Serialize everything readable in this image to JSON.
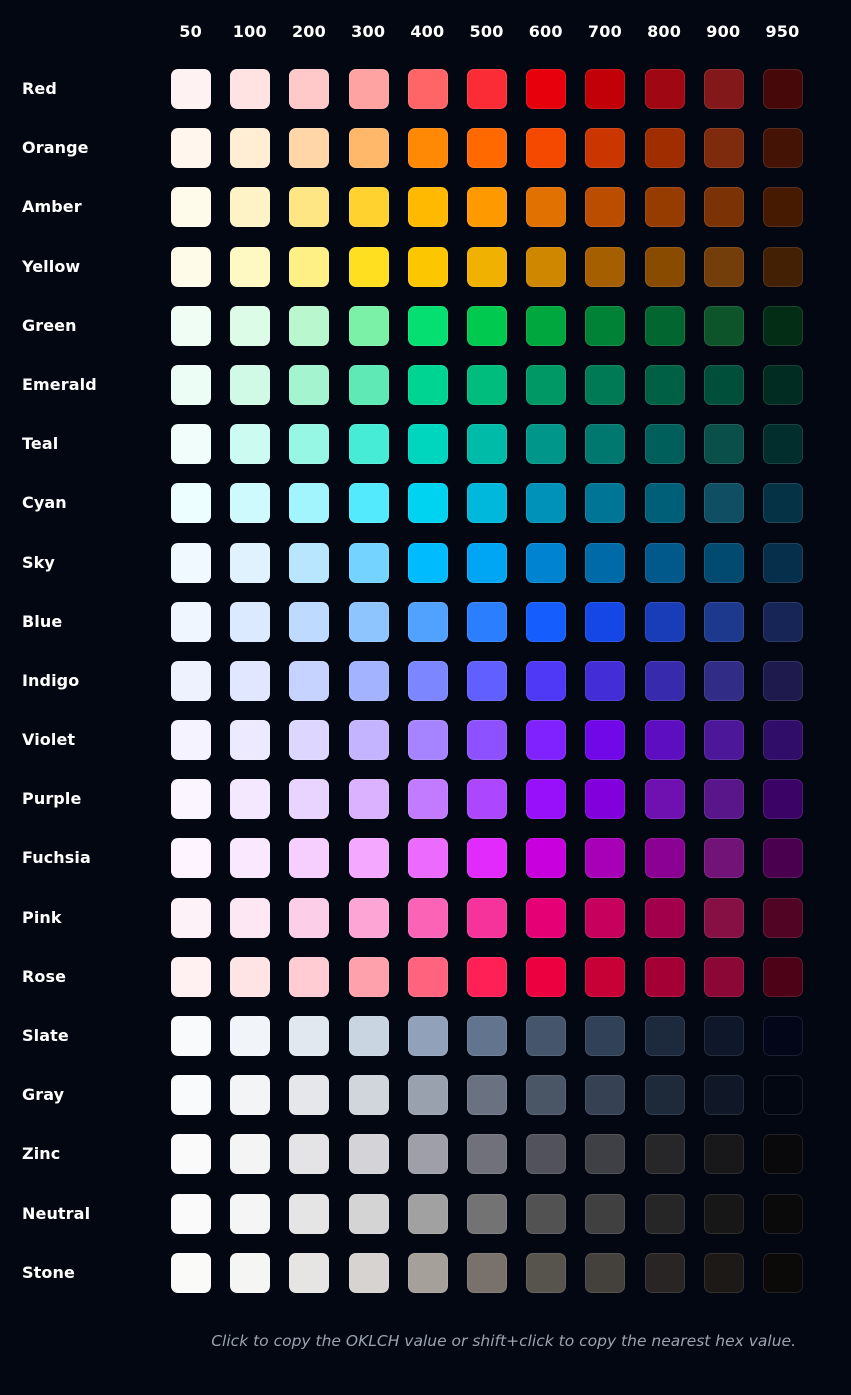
{
  "shades": [
    "50",
    "100",
    "200",
    "300",
    "400",
    "500",
    "600",
    "700",
    "800",
    "900",
    "950"
  ],
  "palette": [
    {
      "name": "Red",
      "colors": [
        "#fef2f2",
        "#ffe2e2",
        "#ffc9c9",
        "#ffa2a2",
        "#ff6467",
        "#fb2c36",
        "#e7000b",
        "#c10007",
        "#9f0712",
        "#82181a",
        "#460809"
      ]
    },
    {
      "name": "Orange",
      "colors": [
        "#fff7ed",
        "#ffedd4",
        "#ffd6a7",
        "#ffb86a",
        "#ff8904",
        "#ff6900",
        "#f54900",
        "#ca3500",
        "#9f2d00",
        "#7e2a0c",
        "#441306"
      ]
    },
    {
      "name": "Amber",
      "colors": [
        "#fffbeb",
        "#fef3c6",
        "#fee685",
        "#ffd230",
        "#ffb900",
        "#fe9a00",
        "#e17100",
        "#bb4d00",
        "#973c00",
        "#7b3306",
        "#461901"
      ]
    },
    {
      "name": "Yellow",
      "colors": [
        "#fefce8",
        "#fef9c2",
        "#fff085",
        "#ffdf20",
        "#fdc700",
        "#f0b100",
        "#d08700",
        "#a65f00",
        "#894b00",
        "#733e0a",
        "#432004"
      ]
    },
    {
      "name": "Green",
      "colors": [
        "#f0fdf4",
        "#dcfce7",
        "#b9f8cf",
        "#7bf1a8",
        "#05df72",
        "#00c950",
        "#00a63e",
        "#008236",
        "#016630",
        "#0d542b",
        "#032e15"
      ]
    },
    {
      "name": "Emerald",
      "colors": [
        "#ecfdf5",
        "#d0fae5",
        "#a4f4cf",
        "#5ee9b5",
        "#00d492",
        "#00bc7d",
        "#009966",
        "#007a55",
        "#006045",
        "#004f3b",
        "#002c22"
      ]
    },
    {
      "name": "Teal",
      "colors": [
        "#f0fdfa",
        "#cbfbf1",
        "#96f7e4",
        "#46ecd5",
        "#00d5be",
        "#00bba7",
        "#009689",
        "#00786f",
        "#005f5a",
        "#0b4f4a",
        "#022f2e"
      ]
    },
    {
      "name": "Cyan",
      "colors": [
        "#ecfeff",
        "#cefafe",
        "#a2f4fd",
        "#53eafd",
        "#00d3f2",
        "#00b8db",
        "#0092b8",
        "#007595",
        "#005f78",
        "#104e64",
        "#053345"
      ]
    },
    {
      "name": "Sky",
      "colors": [
        "#f0f9ff",
        "#dff2fe",
        "#b8e6fe",
        "#74d4ff",
        "#00bcff",
        "#00a6f4",
        "#0084d1",
        "#0069a8",
        "#00598a",
        "#024a70",
        "#052f4a"
      ]
    },
    {
      "name": "Blue",
      "colors": [
        "#eff6ff",
        "#dbeafe",
        "#bedbff",
        "#8ec5ff",
        "#51a2ff",
        "#2b7fff",
        "#155dfc",
        "#1447e6",
        "#193cb8",
        "#1c398e",
        "#162456"
      ]
    },
    {
      "name": "Indigo",
      "colors": [
        "#eef2ff",
        "#e0e7ff",
        "#c6d2ff",
        "#a3b3ff",
        "#7c86ff",
        "#615fff",
        "#4f39f6",
        "#432dd7",
        "#372aac",
        "#312c85",
        "#1e1a4d"
      ]
    },
    {
      "name": "Violet",
      "colors": [
        "#f5f3ff",
        "#ede9fe",
        "#ddd6ff",
        "#c4b4ff",
        "#a684ff",
        "#8e51ff",
        "#7f22fe",
        "#7008e7",
        "#5d0ec0",
        "#4d179a",
        "#2f0d68"
      ]
    },
    {
      "name": "Purple",
      "colors": [
        "#faf5ff",
        "#f3e8ff",
        "#e9d4ff",
        "#dab2ff",
        "#c27aff",
        "#ad46ff",
        "#9810fa",
        "#8200db",
        "#6e11b0",
        "#59168b",
        "#3c0366"
      ]
    },
    {
      "name": "Fuchsia",
      "colors": [
        "#fdf4ff",
        "#fae8ff",
        "#f6cfff",
        "#f4a8ff",
        "#ed6aff",
        "#e12afb",
        "#c800de",
        "#a800b7",
        "#8a0194",
        "#721378",
        "#4b004f"
      ]
    },
    {
      "name": "Pink",
      "colors": [
        "#fdf2f8",
        "#fce7f3",
        "#fccee8",
        "#fda5d5",
        "#fb64b6",
        "#f6339a",
        "#e60076",
        "#c6005c",
        "#a3004c",
        "#861043",
        "#510424"
      ]
    },
    {
      "name": "Rose",
      "colors": [
        "#fff1f2",
        "#ffe4e6",
        "#ffccd3",
        "#ffa1ad",
        "#ff637e",
        "#ff2056",
        "#ec003f",
        "#c70036",
        "#a50036",
        "#8b0836",
        "#4d0218"
      ]
    },
    {
      "name": "Slate",
      "colors": [
        "#f8fafc",
        "#f1f5f9",
        "#e2e8f0",
        "#cad5e2",
        "#90a1b9",
        "#62748e",
        "#45556c",
        "#314158",
        "#1d293d",
        "#0f172b",
        "#020618"
      ]
    },
    {
      "name": "Gray",
      "colors": [
        "#f9fafb",
        "#f3f4f6",
        "#e5e7eb",
        "#d1d5dc",
        "#99a1af",
        "#6a7282",
        "#4a5565",
        "#364153",
        "#1e2939",
        "#101828",
        "#030712"
      ]
    },
    {
      "name": "Zinc",
      "colors": [
        "#fafafa",
        "#f4f4f5",
        "#e4e4e7",
        "#d4d4d8",
        "#9f9fa9",
        "#71717b",
        "#52525c",
        "#3f3f46",
        "#27272a",
        "#18181b",
        "#09090b"
      ]
    },
    {
      "name": "Neutral",
      "colors": [
        "#fafafa",
        "#f5f5f5",
        "#e5e5e5",
        "#d4d4d4",
        "#a1a1a1",
        "#737373",
        "#525252",
        "#404040",
        "#262626",
        "#171717",
        "#0a0a0a"
      ]
    },
    {
      "name": "Stone",
      "colors": [
        "#fafaf9",
        "#f5f5f4",
        "#e7e5e4",
        "#d6d3d1",
        "#a6a09b",
        "#79716b",
        "#57534d",
        "#44403b",
        "#292524",
        "#1c1917",
        "#0c0a09"
      ]
    }
  ],
  "footer_text": "Click to copy the OKLCH value or shift+click to copy the nearest hex value."
}
